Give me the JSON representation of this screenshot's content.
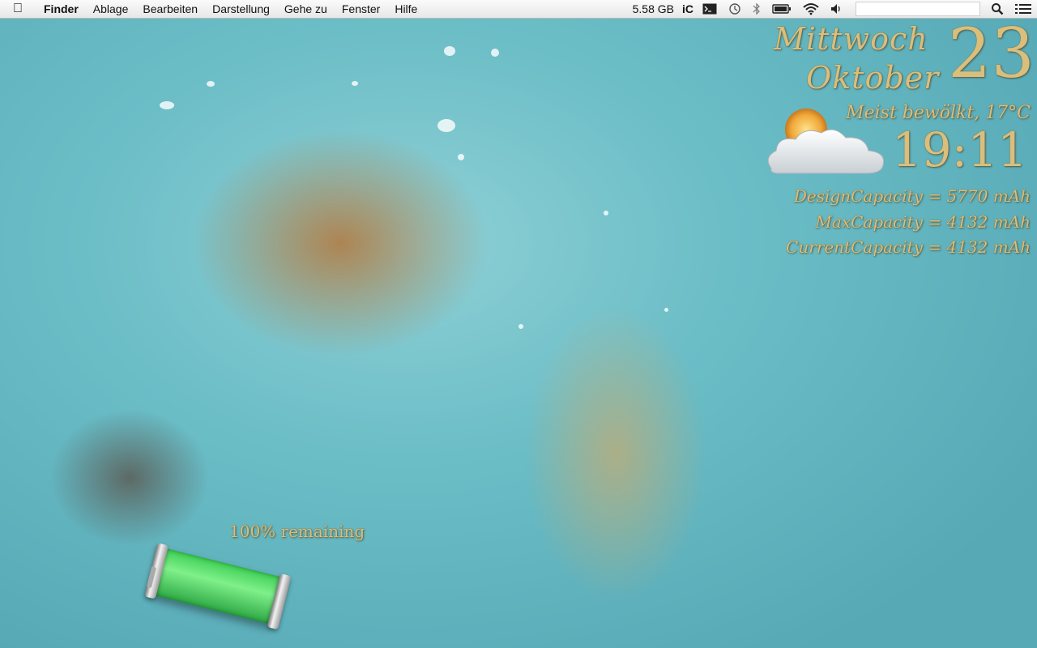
{
  "menubar": {
    "app_name": "Finder",
    "menus": [
      "Ablage",
      "Bearbeiten",
      "Darstellung",
      "Gehe zu",
      "Fenster",
      "Hilfe"
    ],
    "status": {
      "memory": "5.58 GB",
      "istat_label": "iC"
    },
    "icons": [
      "apple-icon",
      "terminal-icon",
      "time-machine-icon",
      "bluetooth-icon",
      "battery-icon",
      "wifi-icon",
      "volume-icon",
      "spotlight-icon",
      "list-icon"
    ]
  },
  "widgets": {
    "weekday": "Mittwoch",
    "month": "Oktober",
    "day": "23",
    "weather": "Meist bewölkt, 17°C",
    "time": "19:11",
    "battery_info": [
      "DesignCapacity = 5770 mAh",
      "MaxCapacity = 4132 mAh",
      "CurrentCapacity = 4132 mAh"
    ],
    "battery_remaining": "100% remaining",
    "battery_level": 1.0
  },
  "colors": {
    "widget_text": "#d9be7c",
    "battery_fill": "#3fd057"
  }
}
